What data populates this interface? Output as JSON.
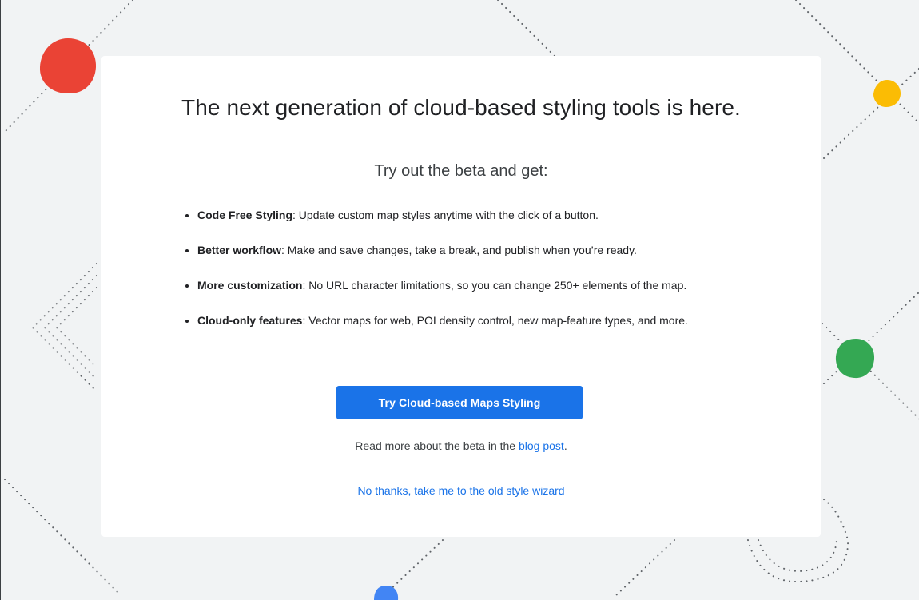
{
  "card": {
    "headline": "The next generation of cloud-based styling tools is here.",
    "subhead": "Try out the beta and get:",
    "features": [
      {
        "title": "Code Free Styling",
        "text": ": Update custom map styles anytime with the click of a button."
      },
      {
        "title": "Better workflow",
        "text": ": Make and save changes, take a break, and publish when you’re ready."
      },
      {
        "title": "More customization",
        "text": ": No URL character limitations, so you can change 250+ elements of the map."
      },
      {
        "title": "Cloud-only features",
        "text": ": Vector maps for web, POI density control, new map-feature types, and more."
      }
    ],
    "cta_label": "Try Cloud-based Maps Styling",
    "read_more_prefix": "Read more about the beta in the ",
    "read_more_link": "blog post",
    "read_more_suffix": ".",
    "decline_link": "No thanks, take me to the old style wizard"
  },
  "colors": {
    "background": "#f1f3f4",
    "primary_blue": "#1a73e8",
    "blob_red": "#ea4335",
    "blob_yellow": "#fbbc04",
    "blob_green": "#34a853",
    "blob_blue": "#4285f4"
  }
}
